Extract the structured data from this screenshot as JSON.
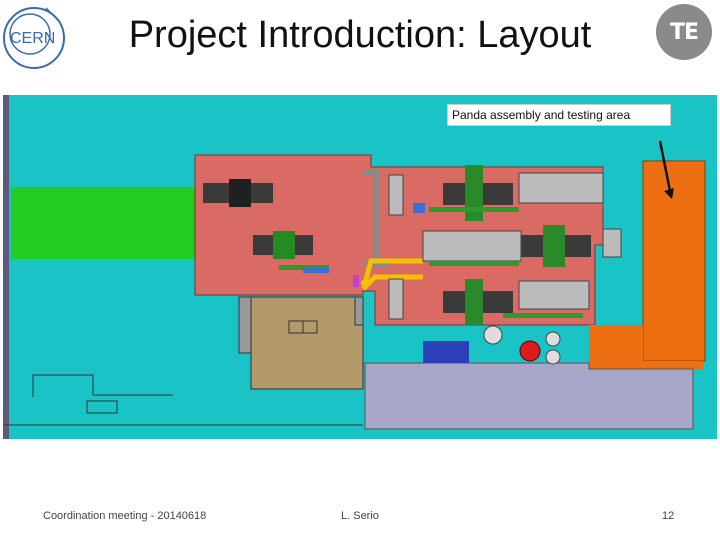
{
  "slide": {
    "title": "Project Introduction: Layout",
    "logo_left": "CERN",
    "logo_right": "TE",
    "callout": "Panda assembly and testing area",
    "footer_left": "Coordination meeting - 20140618",
    "footer_center": "L. Serio",
    "footer_right": "12"
  },
  "colors": {
    "cyan_floor": "#19c3c6",
    "green_zone": "#22cc22",
    "salmon_zone": "#d96b64",
    "orange_zone": "#ee6f12",
    "tan_room": "#b39a6a",
    "purple_zone": "#a7a6c6"
  }
}
